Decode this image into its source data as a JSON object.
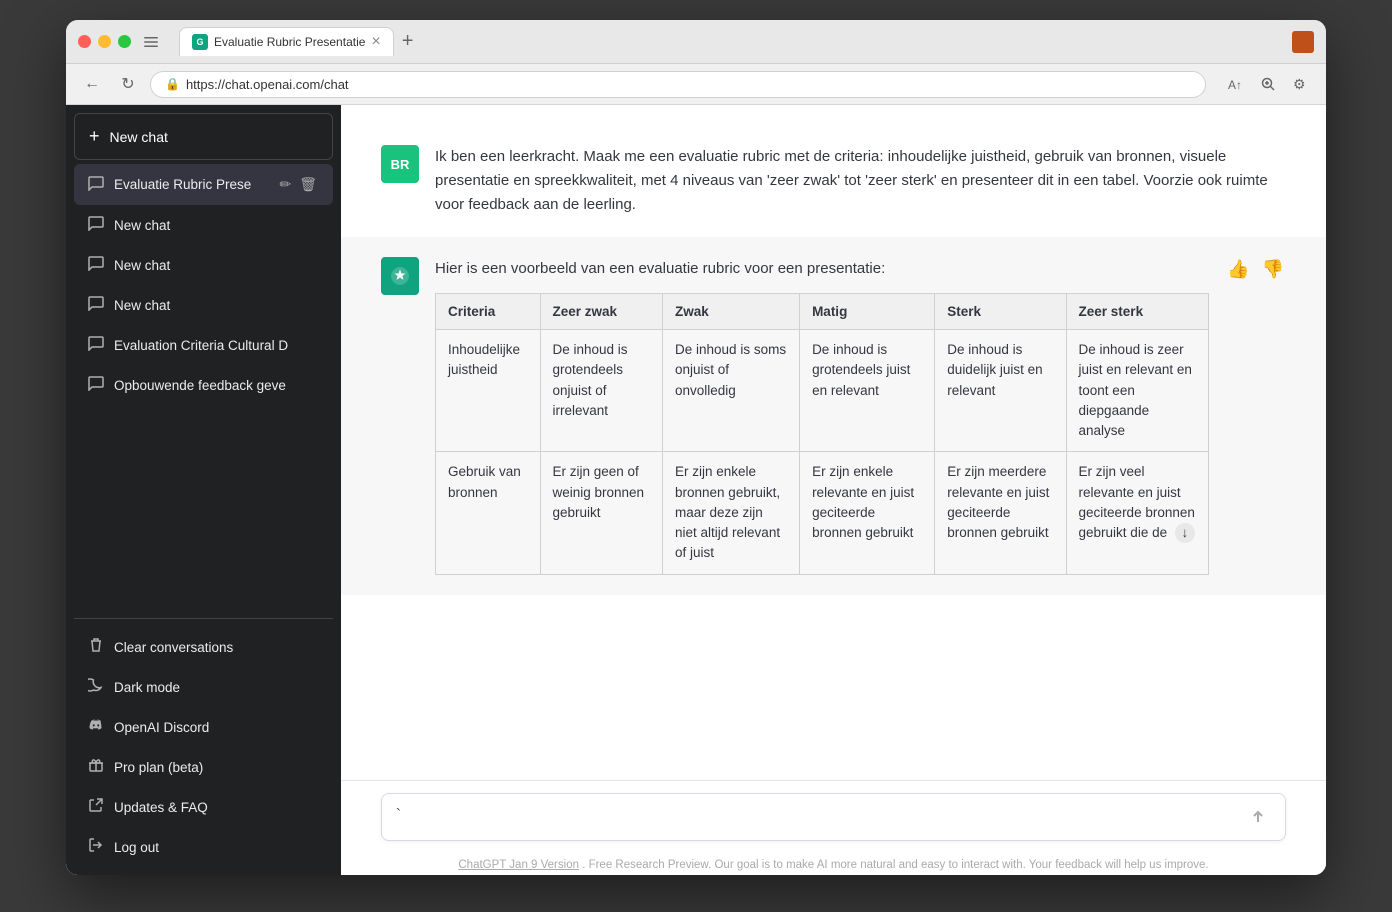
{
  "browser": {
    "url": "https://chat.openai.com/chat",
    "tab_title": "Evaluatie Rubric Presentatie",
    "tab_close": "×",
    "tab_new": "+",
    "nav_back": "←",
    "nav_refresh": "↻"
  },
  "sidebar": {
    "new_chat_label": "New chat",
    "items": [
      {
        "id": "evaluatie-rubric",
        "label": "Evaluatie Rubric Prese",
        "active": true,
        "edit": true,
        "delete": true
      },
      {
        "id": "new-chat-1",
        "label": "New chat",
        "active": false
      },
      {
        "id": "new-chat-2",
        "label": "New chat",
        "active": false
      },
      {
        "id": "new-chat-3",
        "label": "New chat",
        "active": false
      },
      {
        "id": "evaluation-criteria",
        "label": "Evaluation Criteria Cultural D",
        "active": false
      },
      {
        "id": "opbouwende-feedback",
        "label": "Opbouwende feedback geve",
        "active": false
      }
    ],
    "bottom_items": [
      {
        "id": "clear-conversations",
        "label": "Clear conversations",
        "icon": "trash"
      },
      {
        "id": "dark-mode",
        "label": "Dark mode",
        "icon": "moon"
      },
      {
        "id": "openai-discord",
        "label": "OpenAI Discord",
        "icon": "discord"
      },
      {
        "id": "pro-plan",
        "label": "Pro plan (beta)",
        "icon": "gift"
      },
      {
        "id": "updates-faq",
        "label": "Updates & FAQ",
        "icon": "external"
      },
      {
        "id": "log-out",
        "label": "Log out",
        "icon": "logout"
      }
    ]
  },
  "chat": {
    "user_avatar": "BR",
    "user_message": "Ik ben een leerkracht. Maak me een evaluatie rubric met de criteria: inhoudelijke juistheid, gebruik van bronnen, visuele presentatie en spreekkwaliteit, met 4 niveaus van 'zeer zwak' tot 'zeer sterk' en presenteer dit in een tabel. Voorzie ook ruimte voor feedback aan de leerling.",
    "assistant_intro": "Hier is een voorbeeld van een evaluatie rubric voor een presentatie:",
    "table": {
      "headers": [
        "Criteria",
        "Zeer zwak",
        "Zwak",
        "Matig",
        "Sterk",
        "Zeer sterk"
      ],
      "rows": [
        {
          "criteria": "Inhoudelijke juistheid",
          "zeer_zwak": "De inhoud is grotendeels onjuist of irrelevant",
          "zwak": "De inhoud is soms onjuist of onvolledig",
          "matig": "De inhoud is grotendeels juist en relevant",
          "sterk": "De inhoud is duidelijk juist en relevant",
          "zeer_sterk": "De inhoud is zeer juist en relevant en toont een diepgaande analyse"
        },
        {
          "criteria": "Gebruik van bronnen",
          "zeer_zwak": "Er zijn geen of weinig bronnen gebruikt",
          "zwak": "Er zijn enkele bronnen gebruikt, maar deze zijn niet altijd relevant of juist",
          "matig": "Er zijn enkele relevante en juist geciteerde bronnen gebruikt",
          "sterk": "Er zijn meerdere relevante en juist geciteerde bronnen gebruikt",
          "zeer_sterk": "Er zijn veel relevante en juist geciteerde bronnen gebruikt die de"
        }
      ]
    },
    "input_value": "`",
    "input_placeholder": "",
    "footer": "ChatGPT Jan 9 Version",
    "footer_full": "ChatGPT Jan 9 Version. Free Research Preview. Our goal is to make AI more natural and easy to interact with. Your feedback will help us improve."
  }
}
